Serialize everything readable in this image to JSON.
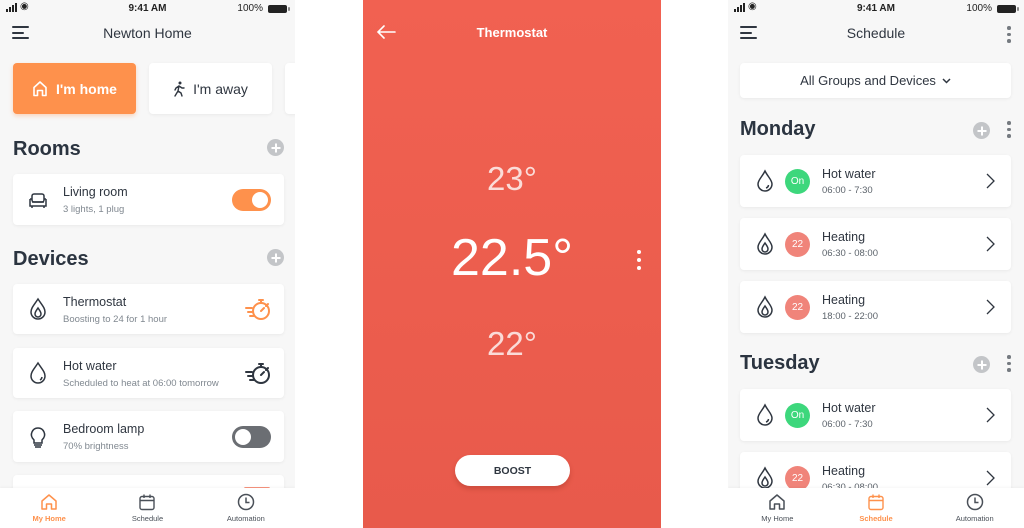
{
  "colors": {
    "accent": "#fe914c",
    "thermostat_bg": "#f16151",
    "on_badge": "#3dd77c",
    "temp_badge": "#f0847a"
  },
  "status_bar": {
    "time": "9:41 AM",
    "battery": "100%"
  },
  "home": {
    "title": "Newton Home",
    "modes": [
      {
        "label": "I'm home",
        "icon": "house-icon",
        "active": true
      },
      {
        "label": "I'm away",
        "icon": "walking-person-icon",
        "active": false
      }
    ],
    "rooms_title": "Rooms",
    "rooms": [
      {
        "name": "Living room",
        "detail": "3 lights, 1 plug",
        "icon": "armchair-icon",
        "on": true
      }
    ],
    "devices_title": "Devices",
    "devices": [
      {
        "name": "Thermostat",
        "detail": "Boosting to 24 for 1 hour",
        "icon": "flame-icon",
        "action": "boost-timer-icon",
        "boosting": true
      },
      {
        "name": "Hot water",
        "detail": "Scheduled to heat at 06:00 tomorrow",
        "icon": "water-drop-icon",
        "action": "boost-timer-icon",
        "boosting": false
      },
      {
        "name": "Bedroom lamp",
        "detail": "70% brightness",
        "icon": "lightbulb-icon",
        "on": false
      }
    ]
  },
  "thermostat": {
    "title": "Thermostat",
    "temp_up": "23°",
    "temp_current": "22.5°",
    "temp_down": "22°",
    "boost_label": "BOOST"
  },
  "schedule": {
    "title": "Schedule",
    "filter": "All Groups and Devices",
    "days": [
      {
        "name": "Monday",
        "items": [
          {
            "name": "Hot water",
            "time": "06:00 - 7:30",
            "badge": "On",
            "icon": "water-drop-icon"
          },
          {
            "name": "Heating",
            "time": "06:30 - 08:00",
            "badge": "22",
            "icon": "flame-icon"
          },
          {
            "name": "Heating",
            "time": "18:00 - 22:00",
            "badge": "22",
            "icon": "flame-icon"
          }
        ]
      },
      {
        "name": "Tuesday",
        "items": [
          {
            "name": "Hot water",
            "time": "06:00 - 7:30",
            "badge": "On",
            "icon": "water-drop-icon"
          },
          {
            "name": "Heating",
            "time": "06:30 - 08:00",
            "badge": "22",
            "icon": "flame-icon"
          }
        ]
      }
    ]
  },
  "tabbar": {
    "tabs": [
      {
        "label": "My Home",
        "icon": "house-icon"
      },
      {
        "label": "Schedule",
        "icon": "calendar-icon"
      },
      {
        "label": "Automation",
        "icon": "clock-icon"
      }
    ]
  }
}
